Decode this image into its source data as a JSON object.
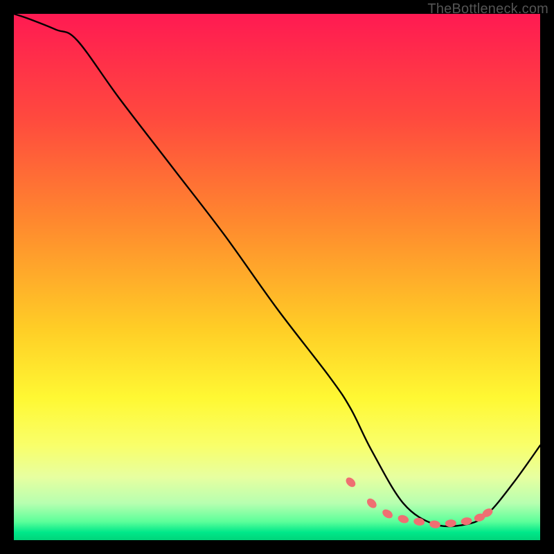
{
  "watermark": "TheBottleneck.com",
  "chart_data": {
    "type": "line",
    "title": "",
    "xlabel": "",
    "ylabel": "",
    "xlim": [
      0,
      100
    ],
    "ylim": [
      0,
      100
    ],
    "series": [
      {
        "name": "curve",
        "x": [
          0,
          3,
          8,
          12,
          20,
          30,
          40,
          50,
          60,
          64,
          68,
          74,
          80,
          86,
          90,
          95,
          100
        ],
        "y": [
          100,
          99,
          97,
          95,
          84,
          71,
          58,
          44,
          31,
          25,
          17,
          7,
          3,
          3,
          5,
          11,
          18
        ]
      }
    ],
    "markers": {
      "name": "highlight-points",
      "x": [
        64,
        68,
        71,
        74,
        77,
        80,
        83,
        86,
        88.5,
        90
      ],
      "y": [
        11,
        7,
        5,
        4,
        3.5,
        3,
        3.2,
        3.6,
        4.3,
        5.2
      ]
    },
    "gradient_stops": [
      {
        "offset": 0.0,
        "color": "#ff1a52"
      },
      {
        "offset": 0.2,
        "color": "#ff4a3e"
      },
      {
        "offset": 0.4,
        "color": "#ff8a2e"
      },
      {
        "offset": 0.6,
        "color": "#ffce26"
      },
      {
        "offset": 0.73,
        "color": "#fff833"
      },
      {
        "offset": 0.82,
        "color": "#f9ff6a"
      },
      {
        "offset": 0.88,
        "color": "#e7ffa0"
      },
      {
        "offset": 0.93,
        "color": "#b7ffb0"
      },
      {
        "offset": 0.965,
        "color": "#5cff9a"
      },
      {
        "offset": 0.985,
        "color": "#00e88a"
      },
      {
        "offset": 1.0,
        "color": "#00d47a"
      }
    ],
    "marker_color": "#ef6f72",
    "curve_color": "#000000",
    "curve_width": 2.4
  }
}
